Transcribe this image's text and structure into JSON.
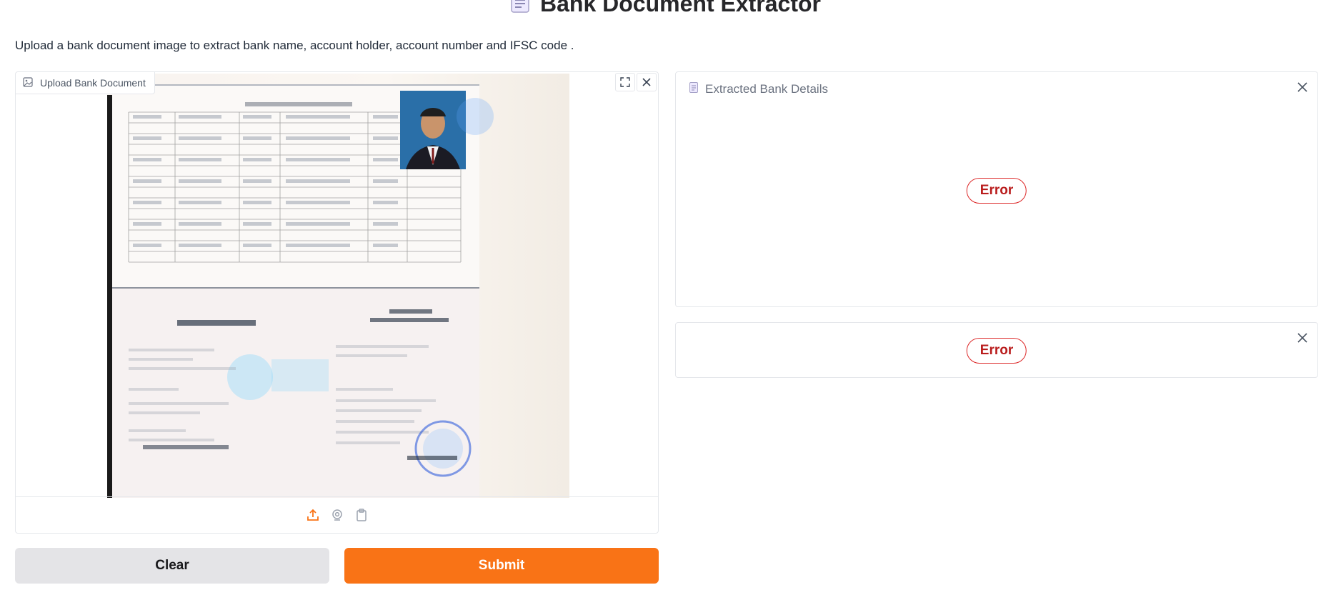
{
  "header": {
    "title": "Bank Document Extractor",
    "description": "Upload a bank document image to extract bank name, account holder, account number and IFSC code ."
  },
  "upload": {
    "label": "Upload Bank Document",
    "toolbar": {
      "fullscreen_icon": "fullscreen-icon",
      "close_icon": "close-icon"
    },
    "sources": [
      "upload-icon",
      "webcam-icon",
      "clipboard-icon"
    ],
    "accent_color": "#f97316"
  },
  "actions": {
    "clear_label": "Clear",
    "submit_label": "Submit"
  },
  "outputs": {
    "details_label": "Extracted Bank Details",
    "details_status": "Error",
    "second_status": "Error"
  },
  "colors": {
    "primary": "#f97316",
    "secondary": "#e4e4e7",
    "error": "#dc2626"
  }
}
